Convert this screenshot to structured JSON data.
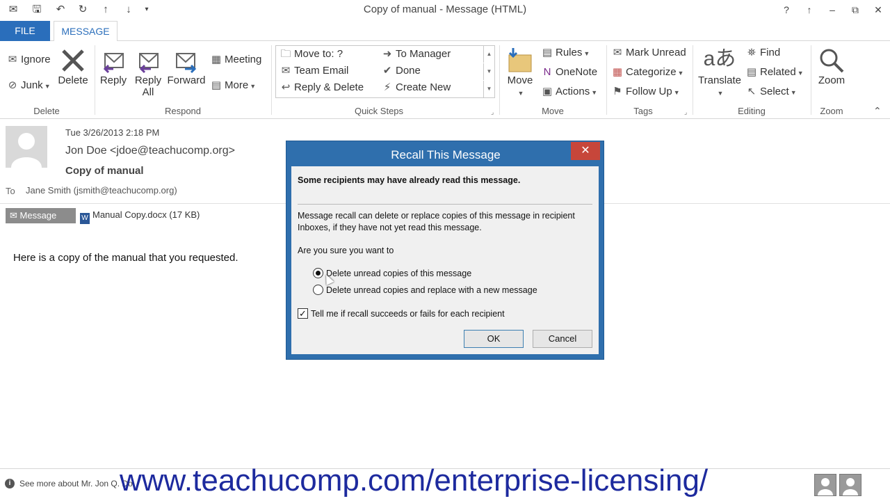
{
  "window": {
    "title": "Copy of manual - Message (HTML)",
    "controls": [
      "?",
      "↑",
      "–",
      "⧉",
      "✕"
    ]
  },
  "tabs": [
    {
      "label": "FILE",
      "active": false
    },
    {
      "label": "MESSAGE",
      "active": true
    }
  ],
  "ribbon": {
    "delete_group": {
      "label": "Delete",
      "ignore": "Ignore",
      "junk": "Junk",
      "delete": "Delete"
    },
    "respond_group": {
      "label": "Respond",
      "reply": "Reply",
      "reply_all_1": "Reply",
      "reply_all_2": "All",
      "forward": "Forward",
      "meeting": "Meeting",
      "more": "More"
    },
    "quicksteps_group": {
      "label": "Quick Steps",
      "items": [
        "Move to: ?",
        "Team Email",
        "Reply & Delete",
        "To Manager",
        "Done",
        "Create New"
      ]
    },
    "move_group": {
      "label": "Move",
      "move": "Move",
      "rules": "Rules",
      "onenote": "OneNote",
      "actions": "Actions"
    },
    "tags_group": {
      "label": "Tags",
      "mark_unread": "Mark Unread",
      "categorize": "Categorize",
      "follow_up": "Follow Up"
    },
    "editing_group": {
      "label": "Editing",
      "translate": "Translate",
      "find": "Find",
      "related": "Related",
      "select": "Select"
    },
    "zoom_group": {
      "label": "Zoom",
      "zoom": "Zoom"
    }
  },
  "message": {
    "date": "Tue 3/26/2013 2:18 PM",
    "from": "Jon Doe <jdoe@teachucomp.org>",
    "subject": "Copy of manual",
    "to_label": "To",
    "to_value": "Jane Smith (jsmith@teachucomp.org)",
    "tab_message": "Message",
    "attachment": "Manual Copy.docx (17 KB)",
    "body": "Here is a copy of the manual that you requested."
  },
  "dialog": {
    "title": "Recall This Message",
    "warning": "Some recipients may have already read this message.",
    "explain": "Message recall can delete or replace copies of this message in recipient Inboxes, if they have not yet read this message.",
    "question": "Are you sure you want to",
    "option1": "Delete unread copies of this message",
    "option2": "Delete unread copies and replace with a new message",
    "selected_option": 1,
    "checkbox_label": "Tell me if recall succeeds or fails for each recipient",
    "checkbox_checked": true,
    "ok": "OK",
    "cancel": "Cancel"
  },
  "footer": {
    "see_more": "See more about Mr. Jon Q. Do",
    "watermark": "www.teachucomp.com/enterprise-licensing/"
  },
  "colors": {
    "accent": "#2a6ebb",
    "dialog_frame": "#2f6fad",
    "close_red": "#c7463a",
    "watermark": "#1d2a9e"
  }
}
